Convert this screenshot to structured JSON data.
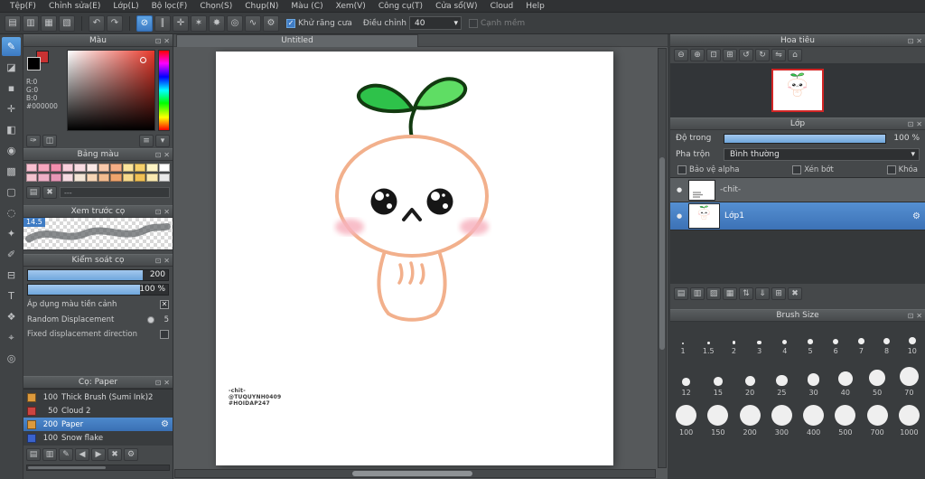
{
  "icons": {
    "float_panel": "⊡",
    "close_panel": "✕",
    "dropdown_arrow": "▾",
    "check": "✓",
    "checkbox_x": "✕",
    "gear": "⚙",
    "visibility_dot": "●"
  },
  "menu": {
    "items": [
      {
        "id": "file",
        "label": "Tệp(F)"
      },
      {
        "id": "edit",
        "label": "Chỉnh sửa(E)"
      },
      {
        "id": "layer",
        "label": "Lớp(L)"
      },
      {
        "id": "filter",
        "label": "Bộ lọc(F)"
      },
      {
        "id": "select",
        "label": "Chọn(S)"
      },
      {
        "id": "snap",
        "label": "Chụp(N)"
      },
      {
        "id": "color",
        "label": "Màu (C)"
      },
      {
        "id": "view",
        "label": "Xem(V)"
      },
      {
        "id": "tool",
        "label": "Công cụ(T)"
      },
      {
        "id": "window",
        "label": "Cửa sổ(W)"
      },
      {
        "id": "cloud",
        "label": "Cloud"
      },
      {
        "id": "help",
        "label": "Help"
      }
    ]
  },
  "toolbar": {
    "file_icons": [
      {
        "id": "new-file",
        "glyph": "▤"
      },
      {
        "id": "open-file",
        "glyph": "▥"
      },
      {
        "id": "save-file",
        "glyph": "▦"
      },
      {
        "id": "export-file",
        "glyph": "▧"
      }
    ],
    "history_icons": [
      {
        "id": "undo",
        "glyph": "↶"
      },
      {
        "id": "redo",
        "glyph": "↷"
      }
    ],
    "snap_icons": [
      {
        "id": "snap-off",
        "glyph": "⊘",
        "selected": true
      },
      {
        "id": "snap-parallel",
        "glyph": "∥"
      },
      {
        "id": "snap-crisscross",
        "glyph": "✛"
      },
      {
        "id": "snap-vanishing-point",
        "glyph": "✶"
      },
      {
        "id": "snap-radial",
        "glyph": "✸"
      },
      {
        "id": "snap-circle",
        "glyph": "◎"
      },
      {
        "id": "snap-curve",
        "glyph": "∿"
      },
      {
        "id": "snap-settings",
        "glyph": "⚙"
      }
    ],
    "antialias_label": "Khử răng cưa",
    "adjust_label": "Điều chỉnh",
    "adjust_value": "40",
    "soft_edge_label": "Cạnh mềm"
  },
  "tools": [
    {
      "id": "brush",
      "glyph": "✎",
      "selected": true
    },
    {
      "id": "eraser",
      "glyph": "◪"
    },
    {
      "id": "dot",
      "glyph": "▪"
    },
    {
      "id": "move",
      "glyph": "✛"
    },
    {
      "id": "fill",
      "glyph": "◧"
    },
    {
      "id": "bucket",
      "glyph": "◉"
    },
    {
      "id": "gradient",
      "glyph": "▩"
    },
    {
      "id": "select",
      "glyph": "▢"
    },
    {
      "id": "lasso",
      "glyph": "◌"
    },
    {
      "id": "magic-wand",
      "glyph": "✦"
    },
    {
      "id": "select-pen",
      "glyph": "✐"
    },
    {
      "id": "select-eraser",
      "glyph": "⊟"
    },
    {
      "id": "text",
      "glyph": "T"
    },
    {
      "id": "pan",
      "glyph": "❖"
    },
    {
      "id": "eyedropper",
      "glyph": "⌖"
    },
    {
      "id": "zoom",
      "glyph": "◎"
    }
  ],
  "left": {
    "color": {
      "title": "Màu",
      "r": "R:0",
      "g": "G:0",
      "b": "B:0",
      "hex": "#000000",
      "mini_icons": [
        {
          "id": "eyedropper-pick",
          "glyph": "✑"
        },
        {
          "id": "color-history",
          "glyph": "◫"
        },
        {
          "id": "color-menu",
          "glyph": "≡"
        },
        {
          "id": "color-options",
          "glyph": "▾"
        }
      ]
    },
    "palette": {
      "title": "Bảng màu",
      "swatches": [
        "#f8bfd0",
        "#f6a6be",
        "#f18fae",
        "#facfdc",
        "#f8dce2",
        "#fbe9e6",
        "#f9c9ab",
        "#f5ae86",
        "#fbe49c",
        "#f6d06b",
        "#fdf4c4",
        "#ffffff",
        "#f2c2ce",
        "#edafc6",
        "#e697b6",
        "#f5dbe1",
        "#f2e5d6",
        "#f7d6b6",
        "#f2bc90",
        "#eea46d",
        "#f7d98c",
        "#f1c155",
        "#f9e9b0",
        "#e9e9e9"
      ],
      "footer_icons": [
        {
          "id": "add-palette-color",
          "glyph": "▤"
        },
        {
          "id": "delete-palette-color",
          "glyph": "✖"
        }
      ],
      "entry_label": "---"
    },
    "preview": {
      "title": "Xem trước cọ",
      "size_tag": "14.5"
    },
    "control": {
      "title": "Kiểm soát cọ",
      "size_value": "200",
      "opacity_value": "100 %",
      "fg_label": "Áp dụng màu tiền cảnh",
      "random_label": "Random Displacement",
      "random_value": "5",
      "fixed_label": "Fixed displacement direction"
    },
    "brushes": {
      "title": "Cọ: Paper",
      "items": [
        {
          "size": "100",
          "name": "Thick Brush (Sumi Ink)2",
          "color": "#dd9a3c",
          "selected": false
        },
        {
          "size": "50",
          "name": "Cloud 2",
          "color": "#cc4440",
          "selected": false
        },
        {
          "size": "200",
          "name": "Paper",
          "color": "#dd9a3c",
          "selected": true
        },
        {
          "size": "100",
          "name": "Snow flake",
          "color": "#3a62cc",
          "selected": false
        }
      ],
      "footer_icons": [
        {
          "id": "add-brush",
          "glyph": "▤"
        },
        {
          "id": "duplicate-brush",
          "glyph": "▥"
        },
        {
          "id": "edit-brush",
          "glyph": "✎"
        },
        {
          "id": "prev-brush",
          "glyph": "◀"
        },
        {
          "id": "next-brush",
          "glyph": "▶"
        },
        {
          "id": "delete-brush",
          "glyph": "✖"
        },
        {
          "id": "brush-config",
          "glyph": "⚙"
        }
      ]
    }
  },
  "canvas": {
    "tab_title": "Untitled",
    "signature": [
      "-chit-",
      "@TUQUYNH0409",
      "#HOIDAP247"
    ]
  },
  "right": {
    "navigator": {
      "title": "Hoa tiêu",
      "tools": [
        {
          "id": "nav-zoom-out",
          "glyph": "⊖"
        },
        {
          "id": "nav-zoom-in",
          "glyph": "⊕"
        },
        {
          "id": "nav-zoom-fit",
          "glyph": "⊡"
        },
        {
          "id": "nav-zoom-actual",
          "glyph": "⊞"
        },
        {
          "id": "nav-rotate-left",
          "glyph": "↺"
        },
        {
          "id": "nav-rotate-right",
          "glyph": "↻"
        },
        {
          "id": "nav-flip",
          "glyph": "⇋"
        },
        {
          "id": "nav-reset",
          "glyph": "⌂"
        }
      ]
    },
    "layers": {
      "title": "Lớp",
      "opacity_label": "Độ trong",
      "opacity_value": "100 %",
      "blend_label": "Pha trộn",
      "blend_value": "Bình thường",
      "alpha_label": "Bảo vệ alpha",
      "clip_label": "Xén bớt",
      "lock_label": "Khóa",
      "items": [
        {
          "name": "-chit-",
          "selected": false
        },
        {
          "name": "Lớp1",
          "selected": true
        }
      ],
      "footer_icons": [
        {
          "id": "new-layer",
          "glyph": "▤"
        },
        {
          "id": "duplicate-layer",
          "glyph": "▥"
        },
        {
          "id": "layer-color",
          "glyph": "▨"
        },
        {
          "id": "new-folder",
          "glyph": "▦"
        },
        {
          "id": "move-layer",
          "glyph": "⇅"
        },
        {
          "id": "merge-down",
          "glyph": "⇓"
        },
        {
          "id": "combine-layer",
          "glyph": "⊞"
        },
        {
          "id": "delete-layer",
          "glyph": "✖"
        }
      ]
    },
    "brush_size": {
      "title": "Brush Size",
      "rows": [
        [
          "1",
          "1.5",
          "2",
          "3",
          "4",
          "5",
          "6",
          "7",
          "8",
          "10"
        ],
        [
          "12",
          "15",
          "20",
          "25",
          "30",
          "40",
          "50",
          "70"
        ],
        [
          "100",
          "150",
          "200",
          "300",
          "400",
          "500",
          "700",
          "1000"
        ]
      ]
    }
  },
  "art_colors": {
    "outline": "#f2b08c",
    "leaf_dark": "#2ec24a",
    "leaf_light": "#5fdd64",
    "leaf_stroke": "#123a10",
    "blush": "#f7b3c0",
    "eye": "#161616"
  }
}
